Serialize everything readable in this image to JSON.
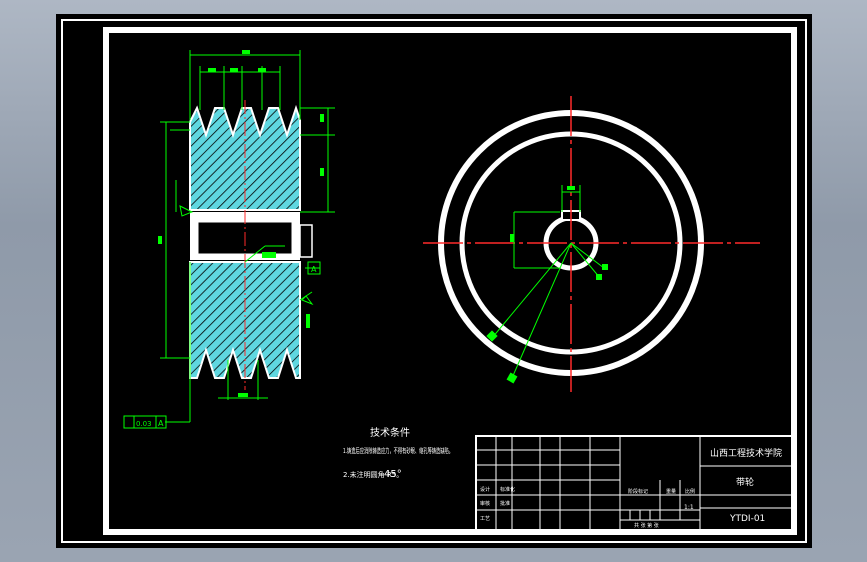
{
  "colors": {
    "background": "#000000",
    "frame": "#ffffff",
    "dimension": "#00ff00",
    "hatch": "#5fd7e0",
    "centerline": "#ff0000",
    "text": "#ffffff"
  },
  "tech_requirements": {
    "title": "技术条件",
    "item1": "1.铸造后应消除铸造应力，不得有砂眼、缩孔等铸造缺陷。",
    "item2": "2.未注明圆角 R5。",
    "angle": "45°"
  },
  "title_block": {
    "school": "山西工程技术学院",
    "part_name": "带轮",
    "drawing_no": "YTDI-01",
    "scale": "1:1",
    "role_design": "设计",
    "role_check": "审核",
    "role_process": "工艺",
    "role_standard": "标准化",
    "role_approve": "批准",
    "stage_mark": "阶段标记",
    "weight": "重量",
    "ratio": "比例",
    "sheet_info": "共 张 第 张"
  },
  "symbols": {
    "datum_label": "A",
    "runout_value": "0.03",
    "roughness": "3.2"
  }
}
